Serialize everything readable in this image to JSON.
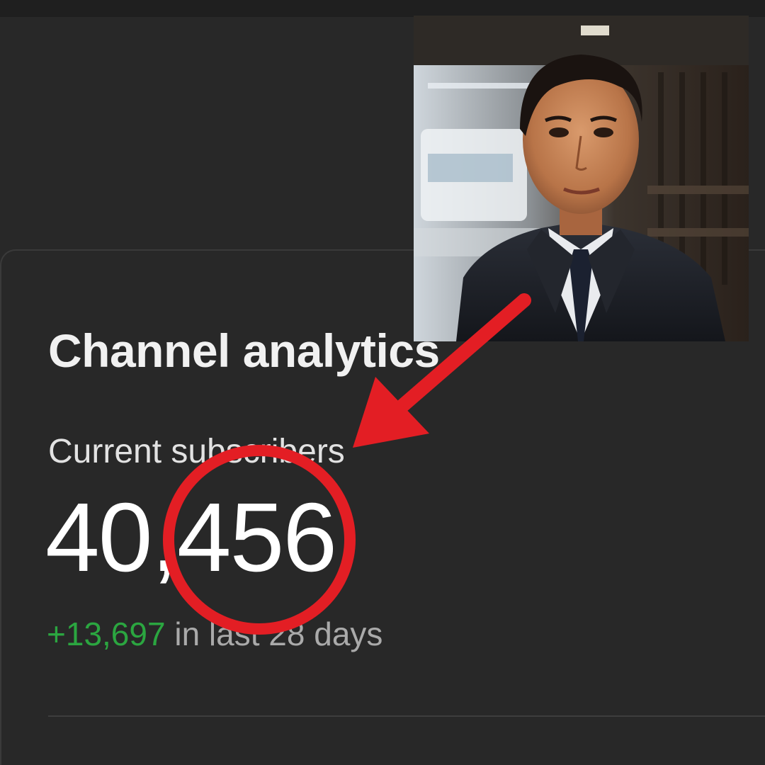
{
  "card": {
    "title": "Channel analytics",
    "subscribers_label": "Current subscribers",
    "subscribers_count": "40,456",
    "delta_value": "+13,697",
    "delta_suffix": " in last 28 days"
  },
  "colors": {
    "background": "#282828",
    "delta_green": "#2ba640",
    "annotation_red": "#e31e24"
  },
  "icons": {
    "photo": "man-in-suit-portrait",
    "arrow": "red-arrow",
    "circle": "red-circle-highlight"
  }
}
